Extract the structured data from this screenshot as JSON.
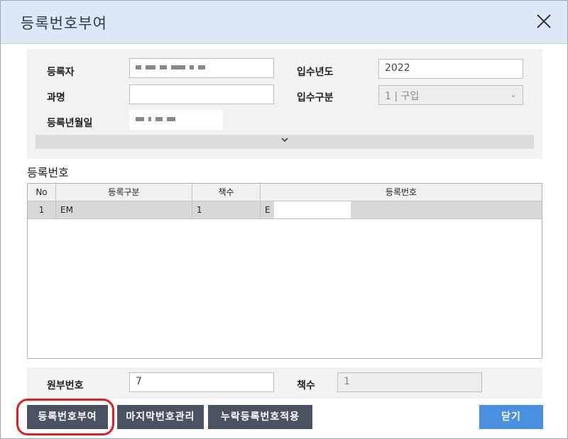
{
  "dialog": {
    "title": "등록번호부여",
    "close_label": "×"
  },
  "form": {
    "registrant_label": "등록자",
    "registrant_value": "",
    "department_label": "과명",
    "department_value": "",
    "reg_date_label": "등록년월일",
    "reg_date_value": "",
    "acq_year_label": "입수년도",
    "acq_year_value": "2022",
    "acq_type_label": "입수구분",
    "acq_type_value": "1 | 구입"
  },
  "section": {
    "title": "등록번호"
  },
  "grid": {
    "headers": [
      "No",
      "등록구분",
      "책수",
      "등록번호"
    ],
    "rows": [
      {
        "no": "1",
        "type": "EM",
        "count": "1",
        "reg_no": "E"
      }
    ]
  },
  "bottom": {
    "original_no_label": "원부번호",
    "original_no_value": "7",
    "count_label": "책수",
    "count_value": "1"
  },
  "buttons": {
    "assign": "등록번호부여",
    "last_manage": "마지막번호관리",
    "missing_apply": "누락등록번호적용",
    "close": "닫기"
  },
  "colors": {
    "titlebar": "#dde7f5",
    "dark_button": "#4b5262",
    "primary_button": "#4a90e2",
    "highlight": "#e02020"
  }
}
